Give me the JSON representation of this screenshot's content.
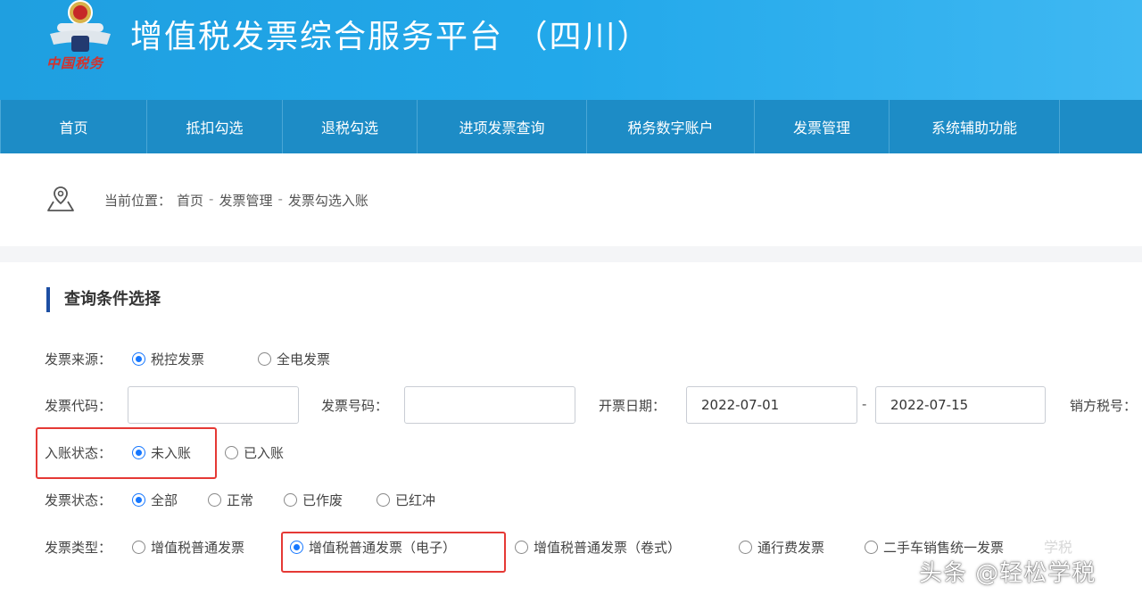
{
  "header": {
    "logo_text": "中国税务",
    "title": "增值税发票综合服务平台 （四川）"
  },
  "nav": {
    "items": [
      "首页",
      "抵扣勾选",
      "退税勾选",
      "进项发票查询",
      "税务数字账户",
      "发票管理",
      "系统辅助功能"
    ]
  },
  "breadcrumb": {
    "prefix": "当前位置：",
    "items": [
      "首页",
      "发票管理",
      "发票勾选入账"
    ],
    "separator": "-"
  },
  "query": {
    "section_title": "查询条件选择",
    "source": {
      "label": "发票来源：",
      "options": [
        "税控发票",
        "全电发票"
      ],
      "selected": "税控发票"
    },
    "invoice_code": {
      "label": "发票代码：",
      "value": ""
    },
    "invoice_number": {
      "label": "发票号码：",
      "value": ""
    },
    "issue_date": {
      "label": "开票日期：",
      "start": "2022-07-01",
      "end": "2022-07-15",
      "separator": "-"
    },
    "seller_tax_id": {
      "label": "销方税号："
    },
    "posting_status": {
      "label": "入账状态：",
      "options": [
        "未入账",
        "已入账"
      ],
      "selected": "未入账"
    },
    "invoice_status": {
      "label": "发票状态：",
      "options": [
        "全部",
        "正常",
        "已作废",
        "已红冲"
      ],
      "selected": "全部"
    },
    "invoice_type": {
      "label": "发票类型：",
      "options": [
        "增值税普通发票",
        "增值税普通发票（电子）",
        "增值税普通发票（卷式）",
        "通行费发票",
        "二手车销售统一发票"
      ],
      "selected": "增值税普通发票（电子）"
    }
  },
  "watermark": {
    "text": "头条 @轻松学税",
    "faint": "学税"
  },
  "colors": {
    "header": "#22a8ea",
    "nav": "#1d8cc6",
    "accent": "#1677ff",
    "highlight_box": "#e53935"
  }
}
